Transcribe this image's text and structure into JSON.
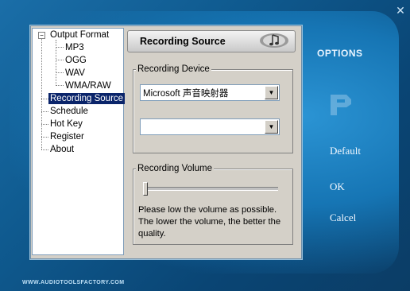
{
  "window": {
    "close_glyph": "✕",
    "options_title": "OPTIONS",
    "footer": "WWW.AUDIOTOOLSFACTORY.COM"
  },
  "side_buttons": {
    "default": "Default",
    "ok": "OK",
    "cancel": "Calcel"
  },
  "tree": {
    "expander_glyph": "−",
    "output_format": "Output Format",
    "formats": [
      "MP3",
      "OGG",
      "WAV",
      "WMA/RAW"
    ],
    "recording_source": "Recording Source",
    "schedule": "Schedule",
    "hot_key": "Hot Key",
    "register": "Register",
    "about": "About",
    "selected": "Recording Source"
  },
  "panel": {
    "header_title": "Recording Source",
    "header_icon": "music-note-icon",
    "recording_device_label": "Recording Device",
    "device_value": "Microsoft 声音映射器",
    "source_value": "",
    "recording_volume_label": "Recording Volume",
    "volume_level": 0,
    "hint": "Please low the volume as possible. The lower the volume, the better the quality."
  }
}
